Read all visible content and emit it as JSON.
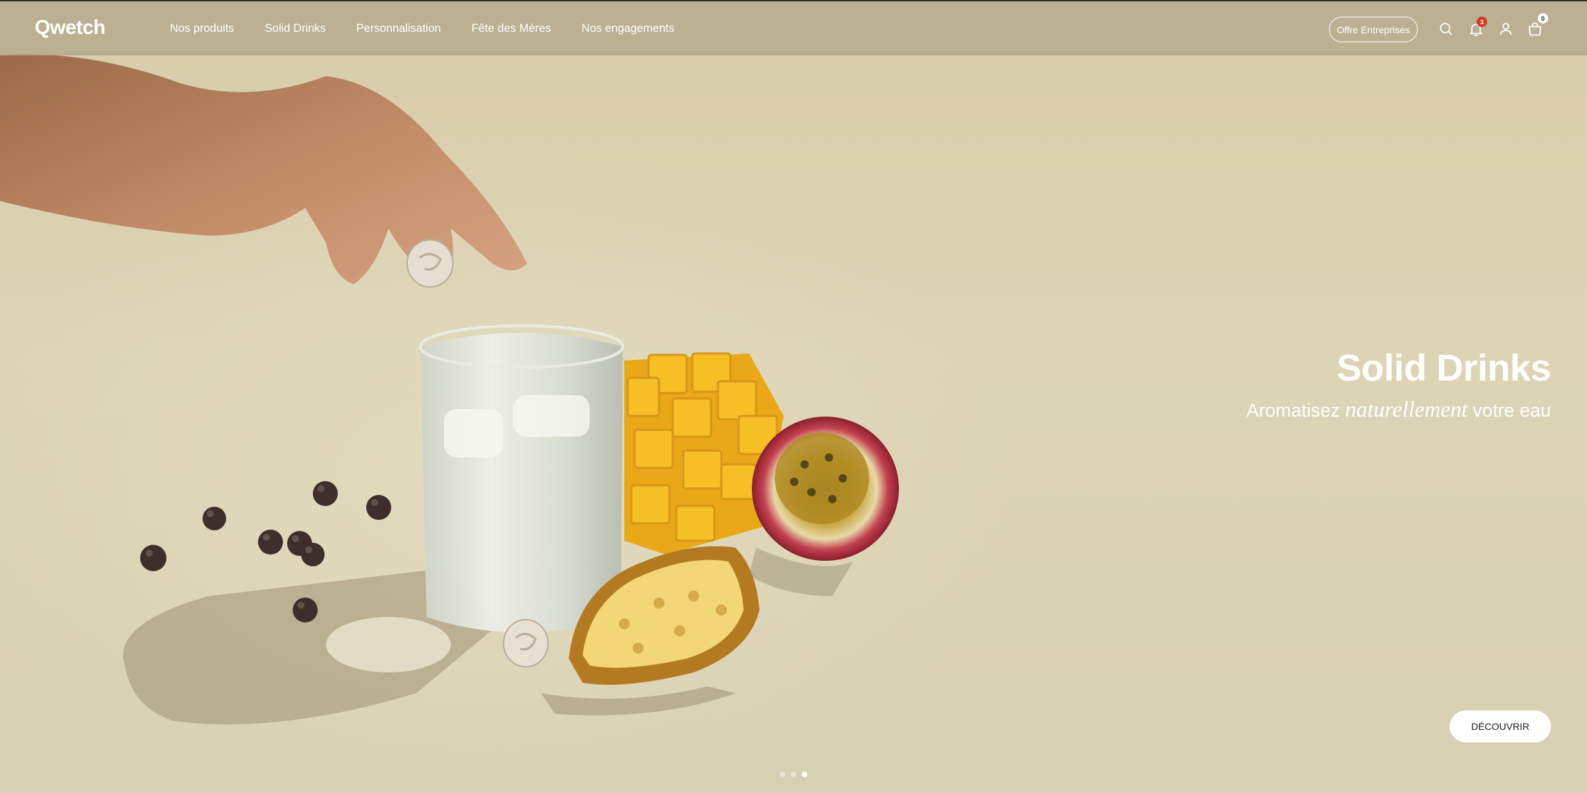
{
  "header": {
    "logo": "Qwetch",
    "nav": [
      {
        "label": "Nos produits"
      },
      {
        "label": "Solid Drinks"
      },
      {
        "label": "Personnalisation"
      },
      {
        "label": "Fête des Mères"
      },
      {
        "label": "Nos engagements"
      }
    ],
    "offer_button": "Offre Entreprises",
    "icons": [
      "search-icon",
      "bell-icon",
      "account-icon",
      "cart-icon"
    ],
    "notifications_count": "3",
    "cart_count": "0"
  },
  "hero": {
    "title": "Solid Drinks",
    "subtitle_before": "Aromatisez ",
    "subtitle_emphasis": "naturellement",
    "subtitle_after": " votre eau",
    "cta": "DÉCOUVRIR",
    "slides_total": 3,
    "active_slide": 3
  },
  "colors": {
    "background": "#d9cfb0",
    "header_overlay": "#b2a88c",
    "text_white": "#ffffff",
    "badge_red": "#d23a2a",
    "mango": "#f2b41c",
    "passion_fruit": "#b8303c"
  }
}
